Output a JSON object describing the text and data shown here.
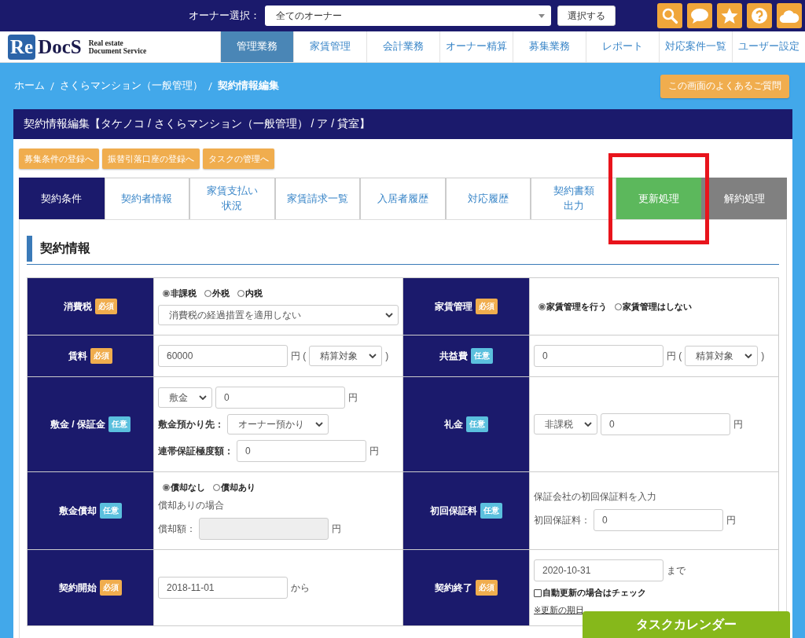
{
  "topbar": {
    "owner_label": "オーナー選択：",
    "owner_select": "全てのオーナー",
    "select_button": "選択する"
  },
  "logo": {
    "mark": "Re",
    "name": "DocS",
    "tagline_1": "Real estate",
    "tagline_2": "Document Service"
  },
  "nav": [
    {
      "label": "管理業務",
      "selected": true
    },
    {
      "label": "家賃管理",
      "selected": false
    },
    {
      "label": "会計業務",
      "selected": false
    },
    {
      "label": "オーナー精算",
      "selected": false
    },
    {
      "label": "募集業務",
      "selected": false
    },
    {
      "label": "レポート",
      "selected": false
    },
    {
      "label": "対応案件一覧",
      "selected": false
    },
    {
      "label": "ユーザー設定",
      "selected": false
    }
  ],
  "breadcrumb": [
    {
      "label": "ホーム",
      "current": false
    },
    {
      "label": "さくらマンション（一般管理）",
      "current": false
    },
    {
      "label": "契約情報編集",
      "current": true
    }
  ],
  "faq_button": "この画面のよくあるご質問",
  "panel_title": "契約情報編集【タケノコ / さくらマンション（一般管理） / ア / 貸室】",
  "action_buttons": [
    "募集条件の登録へ",
    "振替引落口座の登録へ",
    "タスクの管理へ"
  ],
  "tabs": [
    {
      "label": "契約条件",
      "selected": true,
      "highlighted": false
    },
    {
      "label": "契約者情報",
      "selected": false,
      "highlighted": false
    },
    {
      "label": [
        "家賃支払い",
        "状況"
      ],
      "selected": false,
      "highlighted": false
    },
    {
      "label": "家賃請求一覧",
      "selected": false,
      "highlighted": false
    },
    {
      "label": "入居者履歴",
      "selected": false,
      "highlighted": false
    },
    {
      "label": "対応履歴",
      "selected": false,
      "highlighted": false
    },
    {
      "label": [
        "契約書類",
        "出力"
      ],
      "selected": false,
      "highlighted": false
    },
    {
      "label": "更新処理",
      "selected": false,
      "highlighted": true,
      "color": "#5cb85c"
    },
    {
      "label": "解約処理",
      "selected": false,
      "highlighted": false,
      "color": "#808080"
    }
  ],
  "section_title": "契約情報",
  "rows": [
    {
      "cells": [
        {
          "label": "消費税",
          "badge": {
            "text": "必須",
            "kind": "required"
          },
          "lines": [
            [
              {
                "kind": "radios",
                "options": [
                  {
                    "label": "非課税",
                    "selected": true
                  },
                  {
                    "label": "外税",
                    "selected": false
                  },
                  {
                    "label": "内税",
                    "selected": false
                  }
                ]
              }
            ],
            [
              {
                "kind": "select",
                "value": "消費税の経過措置を適用しない"
              }
            ]
          ]
        },
        {
          "label": "家賃管理",
          "badge": {
            "text": "必須",
            "kind": "required"
          },
          "lines": [
            [
              {
                "kind": "radios",
                "options": [
                  {
                    "label": "家賃管理を行う",
                    "selected": true
                  },
                  {
                    "label": "家賃管理はしない",
                    "selected": false
                  }
                ]
              }
            ]
          ]
        }
      ]
    },
    {
      "cells": [
        {
          "label": "賃料",
          "badge": {
            "text": "必須",
            "kind": "required"
          },
          "lines": [
            [
              {
                "kind": "input",
                "value": "60000",
                "disabled": false
              },
              {
                "kind": "text",
                "text": "円 ("
              },
              {
                "kind": "select",
                "value": "精算対象"
              },
              {
                "kind": "text",
                "text": ")"
              }
            ]
          ]
        },
        {
          "label": "共益費",
          "badge": {
            "text": "任意",
            "kind": "optional"
          },
          "lines": [
            [
              {
                "kind": "input",
                "value": "0",
                "disabled": false
              },
              {
                "kind": "text",
                "text": "円 ("
              },
              {
                "kind": "select",
                "value": "精算対象"
              },
              {
                "kind": "text",
                "text": ")"
              }
            ]
          ]
        }
      ]
    },
    {
      "cells": [
        {
          "label": "敷金 / 保証金",
          "badge": {
            "text": "任意",
            "kind": "optional"
          },
          "lines": [
            [
              {
                "kind": "select",
                "value": "敷金"
              },
              {
                "kind": "input",
                "value": "0",
                "disabled": false
              },
              {
                "kind": "text",
                "text": "円"
              }
            ],
            [
              {
                "kind": "label",
                "text": "敷金預かり先："
              },
              {
                "kind": "select",
                "value": "オーナー預かり"
              }
            ],
            [
              {
                "kind": "label",
                "text": "連帯保証極度額："
              },
              {
                "kind": "input",
                "value": "0",
                "disabled": false
              },
              {
                "kind": "text",
                "text": "円"
              }
            ]
          ]
        },
        {
          "label": "礼金",
          "badge": {
            "text": "任意",
            "kind": "optional"
          },
          "lines": [
            [
              {
                "kind": "select",
                "value": "非課税"
              },
              {
                "kind": "input",
                "value": "0",
                "disabled": false
              },
              {
                "kind": "text",
                "text": "円"
              }
            ]
          ]
        }
      ]
    },
    {
      "cells": [
        {
          "label": "敷金償却",
          "badge": {
            "text": "任意",
            "kind": "optional"
          },
          "lines": [
            [
              {
                "kind": "radios",
                "options": [
                  {
                    "label": "償却なし",
                    "selected": true
                  },
                  {
                    "label": "償却あり",
                    "selected": false
                  }
                ]
              }
            ],
            [
              {
                "kind": "text",
                "text": "償却ありの場合"
              }
            ],
            [
              {
                "kind": "text",
                "text": "償却額："
              },
              {
                "kind": "input",
                "disabled": true
              },
              {
                "kind": "text",
                "text": "円"
              }
            ]
          ]
        },
        {
          "label": "初回保証料",
          "badge": {
            "text": "任意",
            "kind": "optional"
          },
          "lines": [
            [
              {
                "kind": "text",
                "text": "保証会社の初回保証料を入力"
              }
            ],
            [
              {
                "kind": "text",
                "text": "初回保証料："
              },
              {
                "kind": "input",
                "value": "0",
                "disabled": false
              },
              {
                "kind": "text",
                "text": "円"
              }
            ]
          ]
        }
      ]
    },
    {
      "cells": [
        {
          "label": "契約開始",
          "badge": {
            "text": "必須",
            "kind": "required"
          },
          "lines": [
            [
              {
                "kind": "input",
                "value": "2018-11-01",
                "disabled": false
              },
              {
                "kind": "text",
                "text": "から"
              }
            ]
          ]
        },
        {
          "label": "契約終了",
          "badge": {
            "text": "必須",
            "kind": "required"
          },
          "lines": [
            [
              {
                "kind": "input",
                "value": "2020-10-31",
                "disabled": false
              },
              {
                "kind": "text",
                "text": "まで"
              }
            ],
            [
              {
                "kind": "checkbox",
                "label": "自動更新の場合はチェック",
                "checked": false
              }
            ],
            [
              {
                "kind": "note",
                "text": "※更新の期日"
              }
            ]
          ]
        }
      ]
    }
  ],
  "task_calendar_button": "タスクカレンダー"
}
